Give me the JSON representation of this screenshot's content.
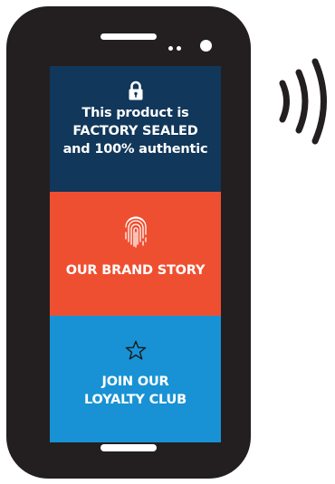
{
  "screen": {
    "sealed": {
      "icon": "lock-icon",
      "text": "This product is\nFACTORY SEALED\nand 100% authentic"
    },
    "story": {
      "icon": "fingerprint-icon",
      "label": "OUR BRAND STORY"
    },
    "loyalty": {
      "icon": "star-icon",
      "label": "JOIN OUR\nLOYALTY CLUB"
    }
  },
  "decorations": {
    "signal_icon": "nfc-signal-icon"
  },
  "colors": {
    "phone_body": "#231f20",
    "sealed_panel": "#11375a",
    "story_panel": "#ef4f31",
    "loyalty_panel": "#1892d4",
    "text": "#ffffff"
  }
}
